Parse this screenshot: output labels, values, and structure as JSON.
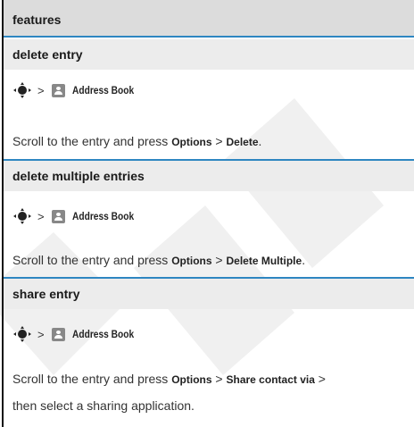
{
  "header": {
    "title": "features"
  },
  "common": {
    "gt": ">",
    "app_name": "Address Book"
  },
  "sections": [
    {
      "title": "delete entry",
      "text_before": "Scroll to the entry and press ",
      "key1": "Options",
      "sep": " > ",
      "key2": "Delete",
      "text_after": "."
    },
    {
      "title": "delete multiple entries",
      "text_before": "Scroll to the entry and press ",
      "key1": "Options",
      "sep": " > ",
      "key2": "Delete Multiple",
      "text_after": "."
    },
    {
      "title": "share entry",
      "text_before": "Scroll to the entry and press ",
      "key1": "Options",
      "sep": " > ",
      "key2": "Share contact via",
      "text_after": " >",
      "line2": "then select a sharing application."
    }
  ],
  "colors": {
    "rule": "#2e86c1",
    "header_bg": "#dcdcdc",
    "section_bg": "#ececec"
  },
  "icons": [
    "nav-key-icon",
    "address-book-icon"
  ]
}
